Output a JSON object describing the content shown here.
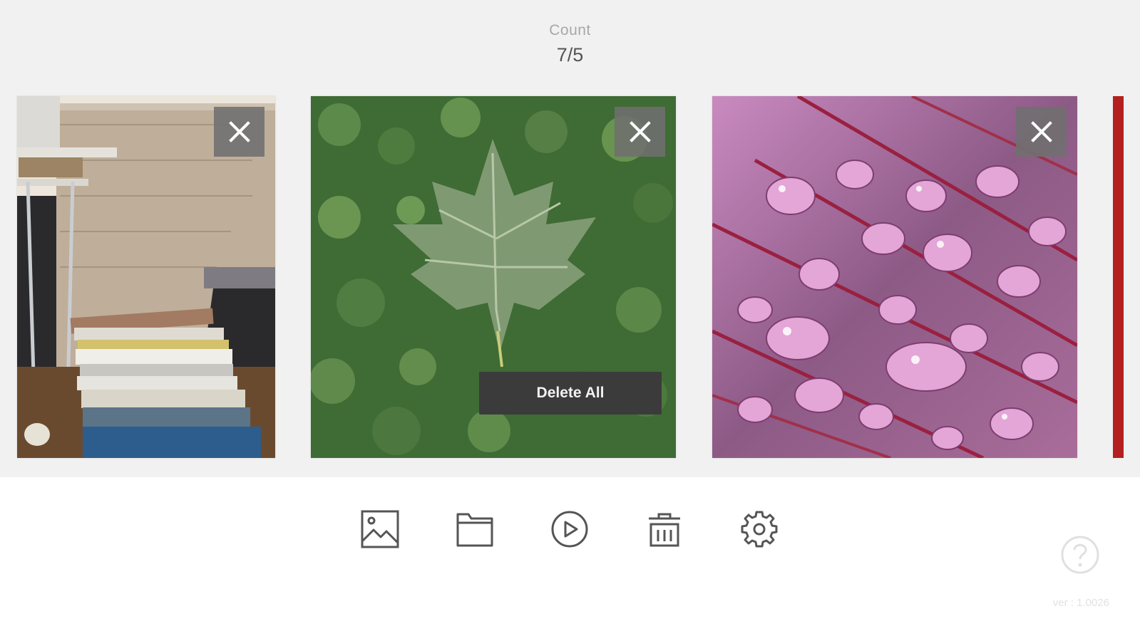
{
  "counter": {
    "label": "Count",
    "value": "7/5"
  },
  "photos": [
    {
      "subject": "bedside table with stack of magazines",
      "remove_icon": "close-icon"
    },
    {
      "subject": "maple leaf on green clover",
      "remove_icon": "close-icon"
    },
    {
      "subject": "water droplets on purple leaf",
      "remove_icon": "close-icon"
    }
  ],
  "delete_all": {
    "label": "Delete All"
  },
  "toolbar": {
    "icons": [
      "image-icon",
      "folder-icon",
      "play-icon",
      "trash-icon",
      "gear-icon"
    ]
  },
  "help": {
    "icon": "help-icon"
  },
  "version": {
    "text": "ver : 1.0026"
  },
  "colors": {
    "gallery_background": "#f1f1f1",
    "accent_red": "#b3201f",
    "button_dark": "#3b3b3b",
    "icon_gray": "#555555"
  }
}
